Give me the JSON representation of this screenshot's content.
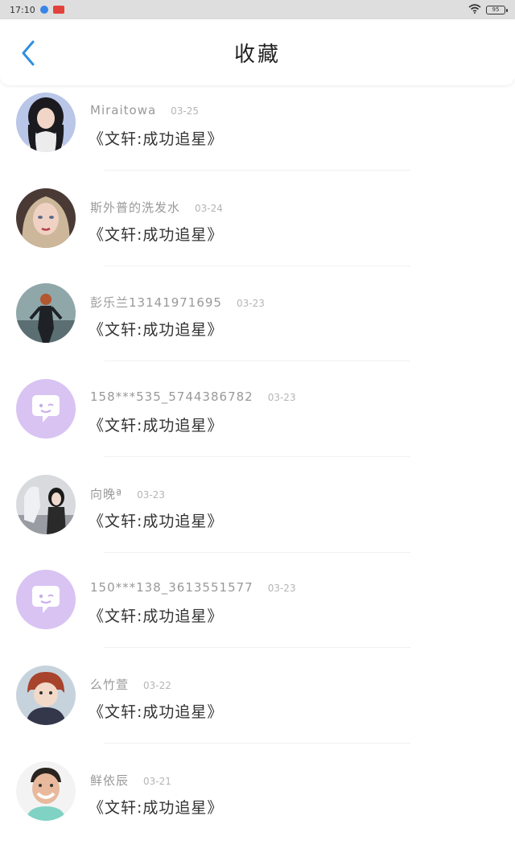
{
  "status_bar": {
    "time": "17:10",
    "battery_text": "95",
    "icons": [
      "app-icon-blue",
      "app-icon-red",
      "wifi-icon",
      "battery-icon"
    ]
  },
  "header": {
    "title": "收藏",
    "back_icon": "chevron-left-icon"
  },
  "colors": {
    "accent": "#2f8fe0",
    "default_avatar": "#d8c3f3"
  },
  "items": [
    {
      "name": "Miraitowa",
      "date": "03-25",
      "message": "《文轩:成功追星》",
      "avatar": "photo-girl"
    },
    {
      "name": "斯外普的洗发水",
      "date": "03-24",
      "message": "《文轩:成功追星》",
      "avatar": "illustration-woman"
    },
    {
      "name": "彭乐兰13141971695",
      "date": "03-23",
      "message": "《文轩:成功追星》",
      "avatar": "hero-figure"
    },
    {
      "name": "158***535_5744386782",
      "date": "03-23",
      "message": "《文轩:成功追星》",
      "avatar": "default-chat"
    },
    {
      "name": "向晚ª",
      "date": "03-23",
      "message": "《文轩:成功追星》",
      "avatar": "photo-people"
    },
    {
      "name": "150***138_3613551577",
      "date": "03-23",
      "message": "《文轩:成功追星》",
      "avatar": "default-chat"
    },
    {
      "name": "么竹萱",
      "date": "03-22",
      "message": "《文轩:成功追星》",
      "avatar": "anime-boy"
    },
    {
      "name": "鲜依辰",
      "date": "03-21",
      "message": "《文轩:成功追星》",
      "avatar": "photo-man"
    }
  ]
}
